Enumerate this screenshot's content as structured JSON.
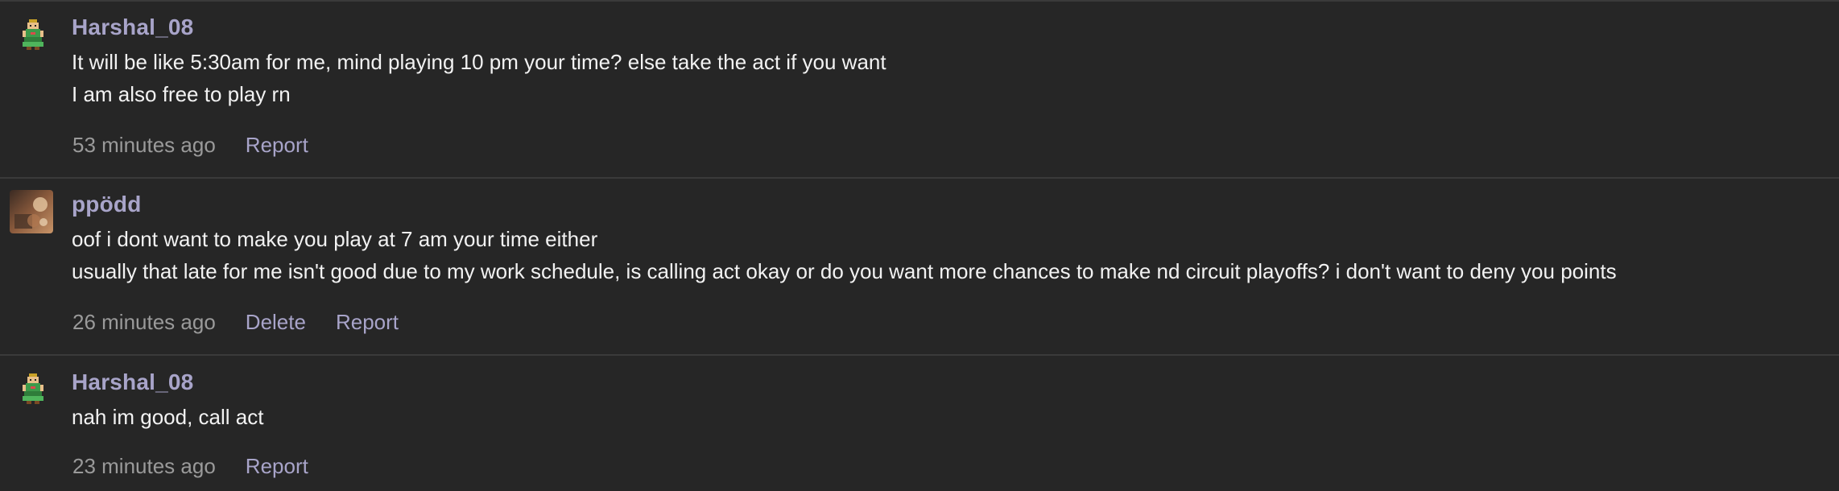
{
  "comments": [
    {
      "username": "Harshal_08",
      "avatar_icon": "pixel-character-green-icon",
      "lines": [
        "It will be like 5:30am for me, mind playing 10 pm your time? else take the act if you want",
        "I am also free to play rn"
      ],
      "time": "53 minutes ago",
      "actions": [
        "Report"
      ]
    },
    {
      "username": "ppödd",
      "avatar_icon": "photo-avatar-icon",
      "lines": [
        "oof i dont want to make you play at 7 am your time either",
        "usually that late for me isn't good due to my work schedule, is calling act okay or do you want more chances to make nd circuit playoffs? i don't want to deny you points"
      ],
      "time": "26 minutes ago",
      "actions": [
        "Delete",
        "Report"
      ]
    },
    {
      "username": "Harshal_08",
      "avatar_icon": "pixel-character-green-icon",
      "lines": [
        "nah im good, call act"
      ],
      "time": "23 minutes ago",
      "actions": [
        "Report"
      ]
    }
  ]
}
